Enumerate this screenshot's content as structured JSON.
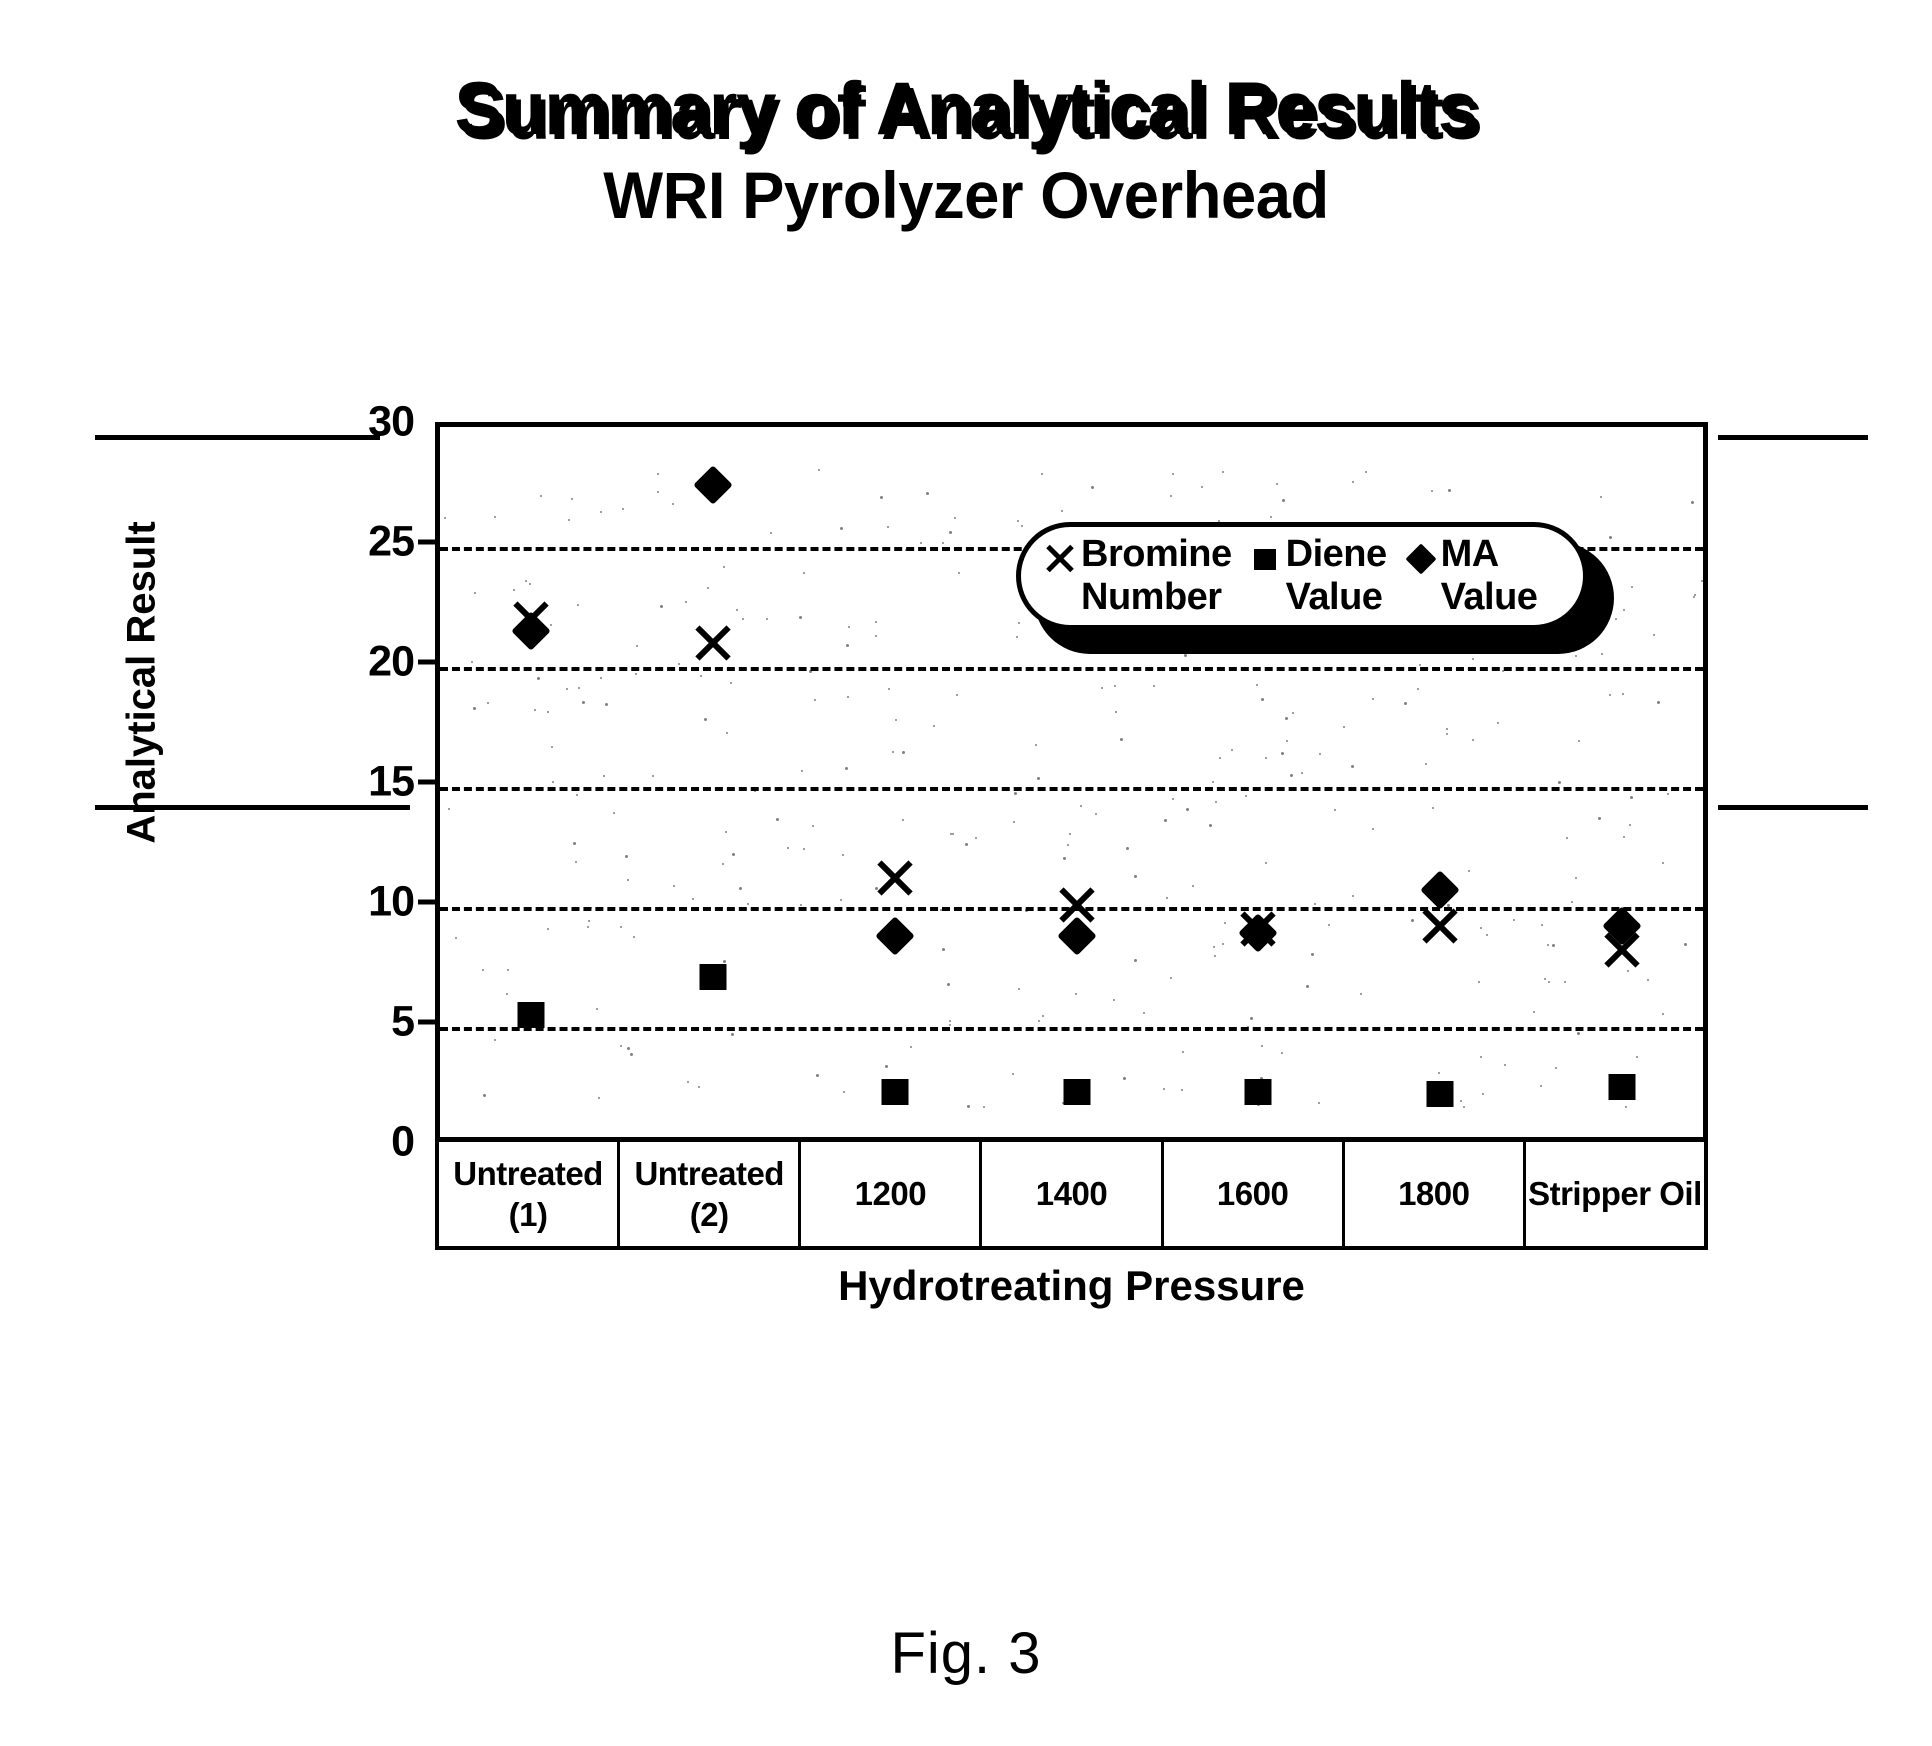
{
  "title": {
    "line1": "Summary of Analytical Results",
    "line2": "WRI Pyrolyzer Overhead"
  },
  "figure_caption": "Fig.  3",
  "axes": {
    "ylabel": "Analytical Result",
    "xlabel": "Hydrotreating Pressure",
    "yticks": [
      "30",
      "25",
      "20",
      "15",
      "10",
      "5",
      "0"
    ]
  },
  "legend": {
    "items": [
      {
        "symbol": "cross-icon",
        "line1": "Bromine",
        "line2": "Number"
      },
      {
        "symbol": "square-icon",
        "line1": "Diene",
        "line2": "Value"
      },
      {
        "symbol": "diamond-icon",
        "line1": "MA",
        "line2": "Value"
      }
    ]
  },
  "categories": [
    {
      "line1": "Untreated",
      "line2": "(1)"
    },
    {
      "line1": "Untreated",
      "line2": "(2)"
    },
    {
      "line1": "1200",
      "line2": ""
    },
    {
      "line1": "1400",
      "line2": ""
    },
    {
      "line1": "1600",
      "line2": ""
    },
    {
      "line1": "1800",
      "line2": ""
    },
    {
      "line1": "Stripper Oil",
      "line2": ""
    }
  ],
  "chart_data": {
    "type": "scatter",
    "title": "Summary of Analytical Results / WRI Pyrolyzer Overhead",
    "xlabel": "Hydrotreating Pressure",
    "ylabel": "Analytical Result",
    "ylim": [
      0,
      30
    ],
    "ytick_step": 5,
    "grid": "horizontal-dashed",
    "legend_position": "inside-top-right",
    "categories": [
      "Untreated (1)",
      "Untreated (2)",
      "1200",
      "1400",
      "1600",
      "1800",
      "Stripper Oil"
    ],
    "series": [
      {
        "name": "Bromine Number",
        "marker": "cross",
        "values": [
          22.0,
          21.0,
          11.2,
          10.1,
          9.1,
          9.2,
          8.2
        ]
      },
      {
        "name": "Diene Value",
        "marker": "square",
        "values": [
          5.5,
          7.1,
          2.3,
          2.3,
          2.3,
          2.2,
          2.5
        ]
      },
      {
        "name": "MA Value",
        "marker": "diamond",
        "values": [
          21.5,
          27.6,
          8.8,
          8.8,
          8.9,
          10.7,
          9.2
        ]
      }
    ]
  }
}
